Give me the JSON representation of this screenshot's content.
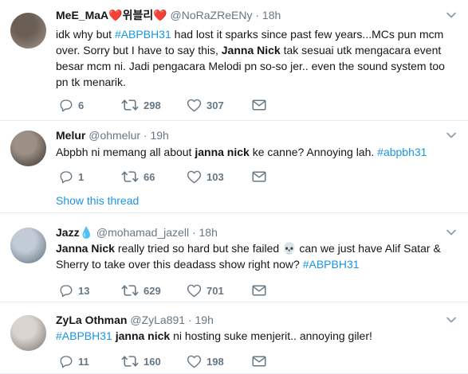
{
  "tweets": [
    {
      "name": "MeE_MaA",
      "name_suffix": "❤️위블리❤️",
      "handle": "@NoRaZReENy",
      "time": "18h",
      "text_parts": [
        {
          "t": "idk why but ",
          "style": "normal"
        },
        {
          "t": "#ABPBH31",
          "style": "tag"
        },
        {
          "t": " had lost it sparks since past few years...MCs pun mcm over. Sorry but I have to say this, ",
          "style": "normal"
        },
        {
          "t": "Janna Nick",
          "style": "bold"
        },
        {
          "t": " tak sesuai utk mengacara event besar mcm ni. Jadi pengacara Melodi pn so-so jer.. even the sound system too pn tk menarik.",
          "style": "normal"
        }
      ],
      "replies": "6",
      "retweets": "298",
      "likes": "307"
    },
    {
      "name": "Melur",
      "handle": "@ohmelur",
      "time": "19h",
      "text_parts": [
        {
          "t": "Abpbh ni memang all about ",
          "style": "normal"
        },
        {
          "t": "janna nick",
          "style": "bold"
        },
        {
          "t": " ke canne? Annoying lah. ",
          "style": "normal"
        },
        {
          "t": "#abpbh31",
          "style": "tag"
        }
      ],
      "replies": "1",
      "retweets": "66",
      "likes": "103",
      "show_thread": "Show this thread"
    },
    {
      "name": "Jazz",
      "name_suffix": "💧",
      "handle": "@mohamad_jazell",
      "time": "18h",
      "text_parts": [
        {
          "t": "Janna Nick",
          "style": "bold"
        },
        {
          "t": " really tried so hard but she failed 💀 can we just have Alif Satar & Sherry to take over this deadass show right now? ",
          "style": "normal"
        },
        {
          "t": "#ABPBH31",
          "style": "tag"
        }
      ],
      "replies": "13",
      "retweets": "629",
      "likes": "701"
    },
    {
      "name": "ZyLa Othman",
      "handle": "@ZyLa891",
      "time": "19h",
      "text_parts": [
        {
          "t": "#ABPBH31",
          "style": "tag"
        },
        {
          "t": " ",
          "style": "normal"
        },
        {
          "t": "janna nick",
          "style": "bold"
        },
        {
          "t": " ni hosting suke menjerit.. annoying giler!",
          "style": "normal"
        }
      ],
      "replies": "11",
      "retweets": "160",
      "likes": "198"
    }
  ],
  "colors": {
    "link": "#1b95e0",
    "muted": "#657786",
    "text": "#14171a",
    "divider": "#e6ecf0"
  },
  "icons": [
    "reply-icon",
    "retweet-icon",
    "like-icon",
    "message-icon",
    "chevron-down-icon"
  ]
}
